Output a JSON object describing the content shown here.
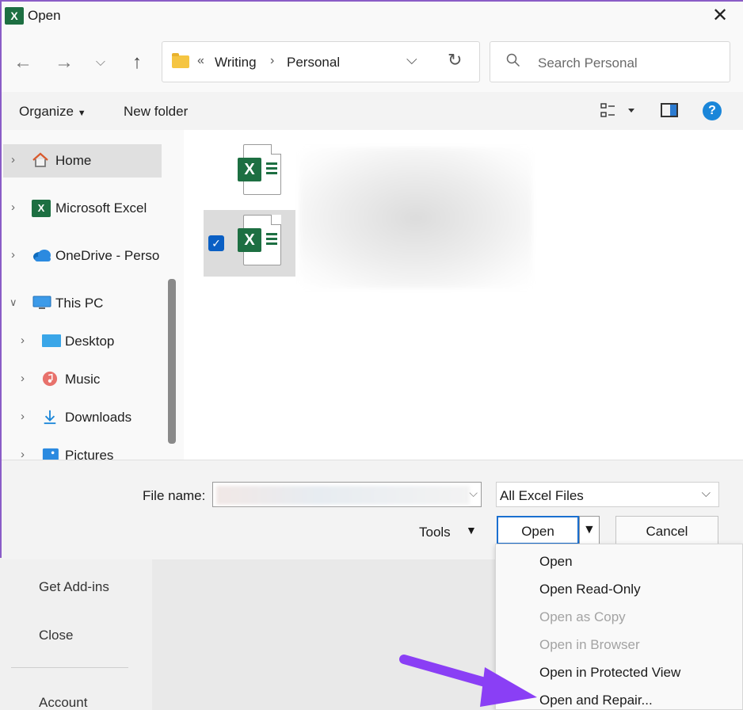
{
  "colors": {
    "accent": "#1a6fd0",
    "excel_green": "#1d6f42",
    "annotation_arrow": "#8a3ff5"
  },
  "window": {
    "title": "Open",
    "close_icon": "close-icon"
  },
  "address": {
    "overflow": "«",
    "crumbs": [
      "Writing",
      "Personal"
    ],
    "separator": "›"
  },
  "search": {
    "placeholder": "Search Personal"
  },
  "toolbar": {
    "organize": "Organize",
    "new_folder": "New folder"
  },
  "sidebar": {
    "items": [
      {
        "label": "Home",
        "icon": "home-icon"
      },
      {
        "label": "Microsoft Excel",
        "icon": "excel-icon"
      },
      {
        "label": "OneDrive - Perso",
        "icon": "onedrive-icon"
      },
      {
        "label": "This PC",
        "icon": "pc-icon"
      },
      {
        "label": "Desktop",
        "icon": "desktop-icon"
      },
      {
        "label": "Music",
        "icon": "music-icon"
      },
      {
        "label": "Downloads",
        "icon": "downloads-icon"
      },
      {
        "label": "Pictures",
        "icon": "pictures-icon"
      }
    ]
  },
  "footer": {
    "file_name_label": "File name:",
    "file_type": "All Excel Files",
    "tools": "Tools",
    "open": "Open",
    "cancel": "Cancel"
  },
  "open_menu": {
    "items": [
      {
        "label": "Open",
        "enabled": true
      },
      {
        "label": "Open Read-Only",
        "enabled": true
      },
      {
        "label": "Open as Copy",
        "enabled": false
      },
      {
        "label": "Open in Browser",
        "enabled": false
      },
      {
        "label": "Open in Protected View",
        "enabled": true
      },
      {
        "label": "Open and Repair...",
        "enabled": true
      }
    ]
  },
  "backstage": {
    "items": [
      "Get Add-ins",
      "Close",
      "Account"
    ]
  }
}
